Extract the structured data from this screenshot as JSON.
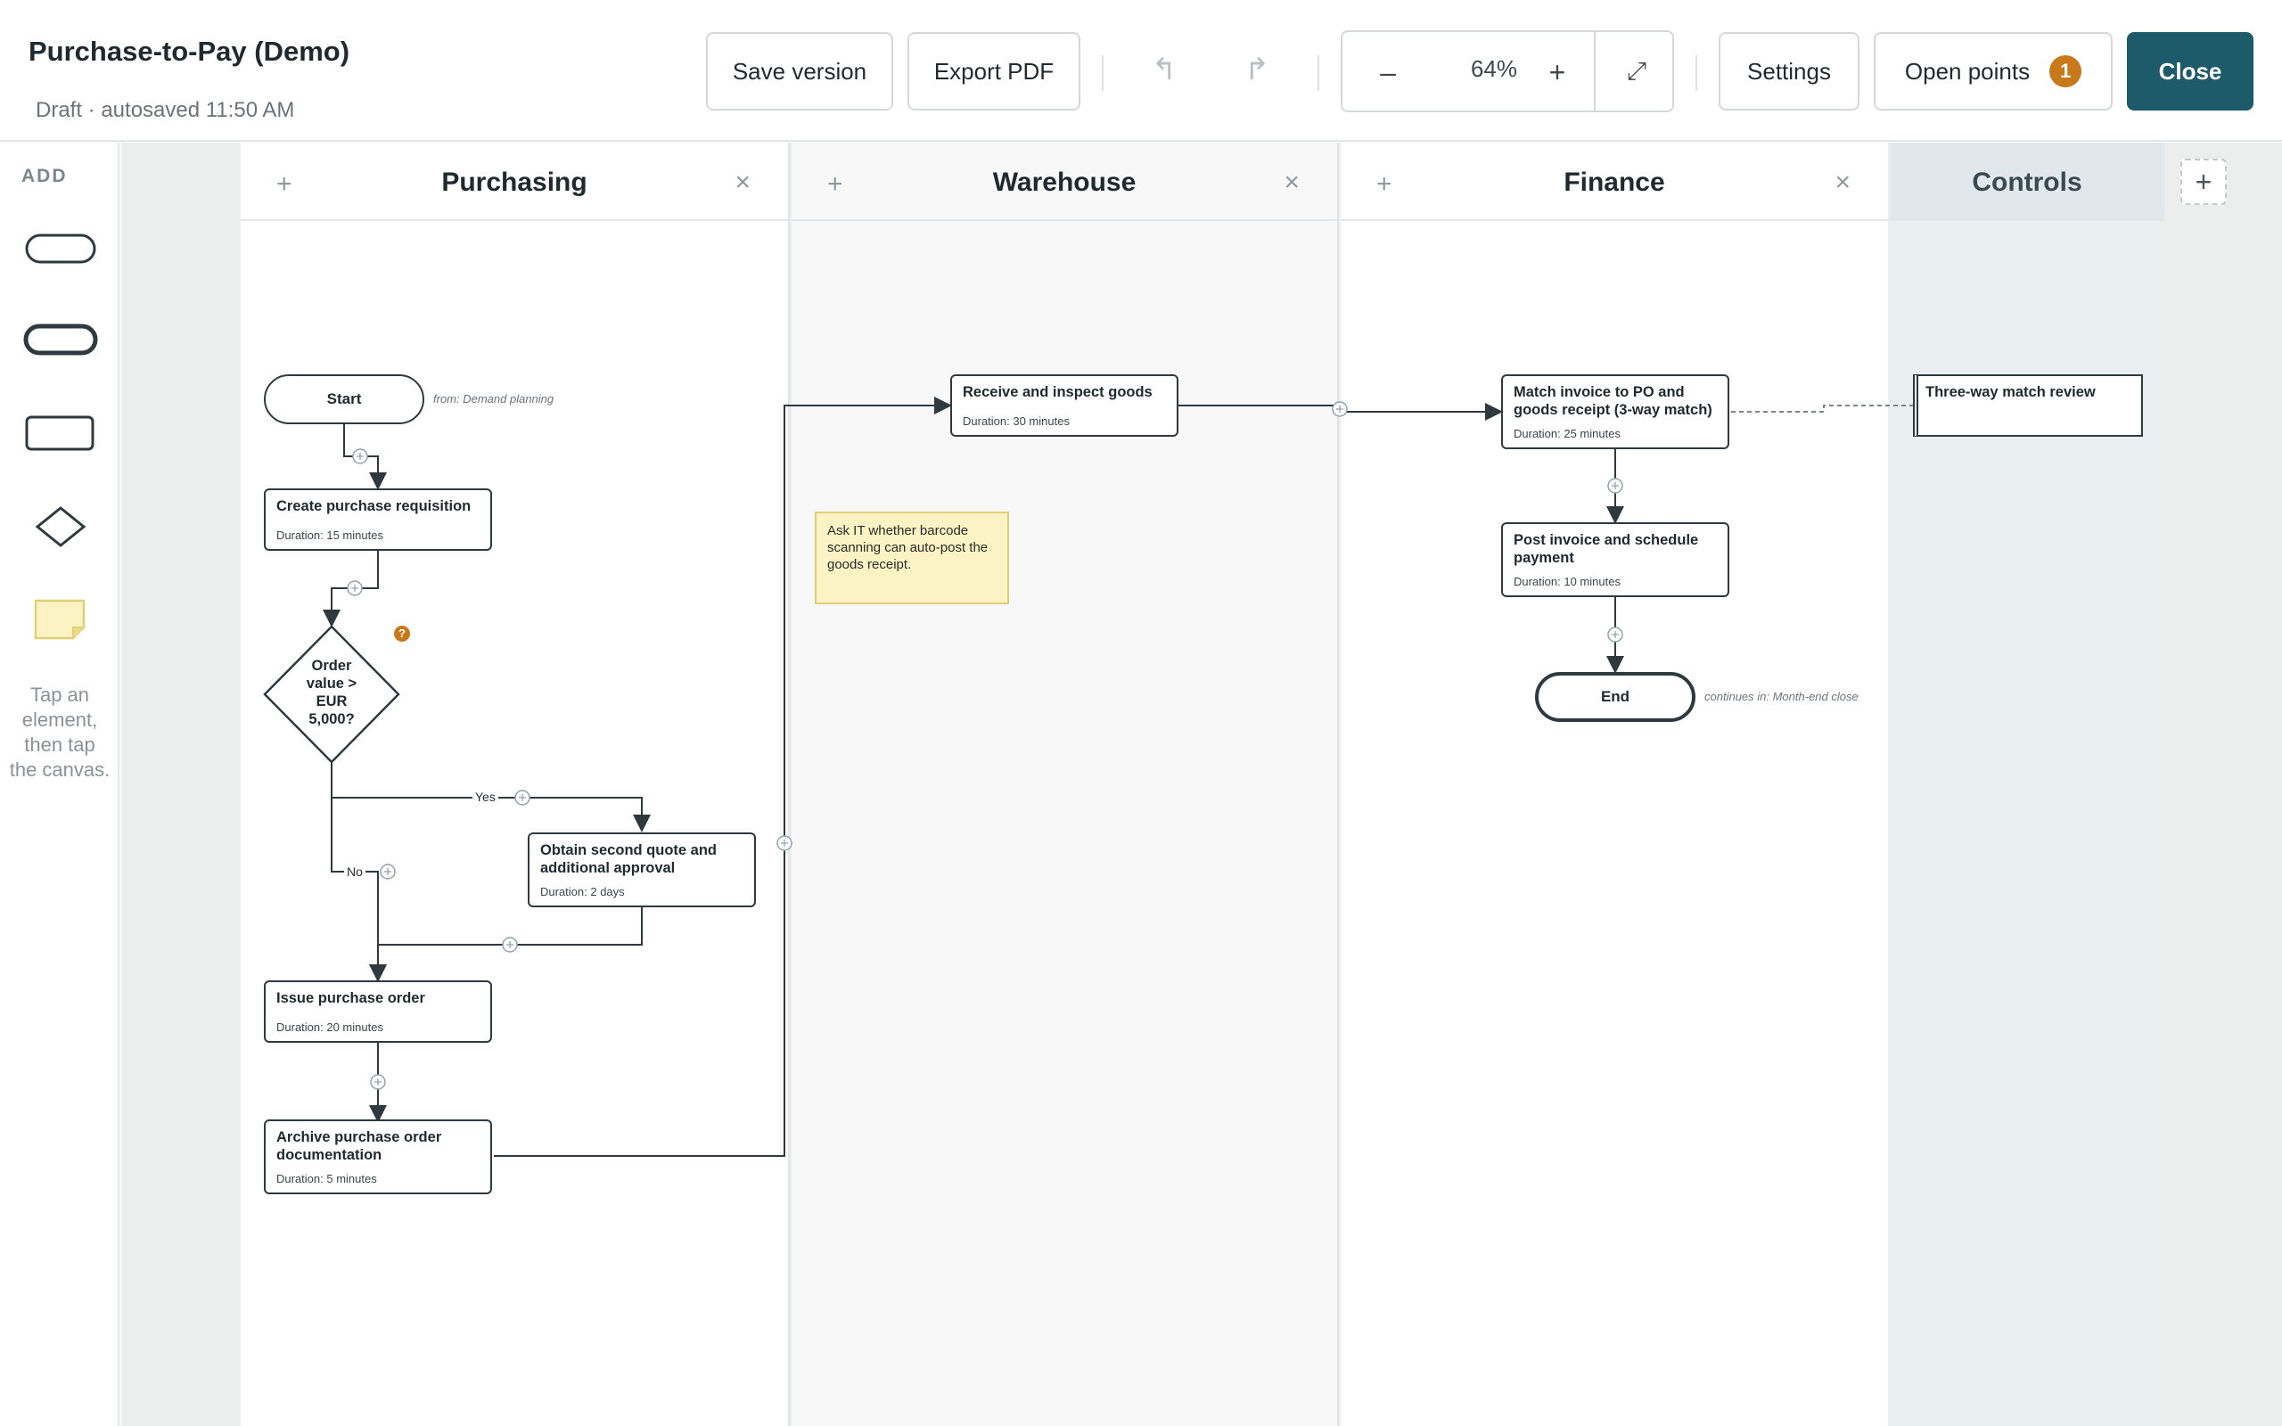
{
  "header": {
    "title": "Purchase-to-Pay (Demo)",
    "subtitle": "Draft · autosaved 11:50 AM",
    "save_version": "Save version",
    "export_pdf": "Export PDF",
    "undo_icon": "↰",
    "redo_icon": "↱",
    "zoom_minus": "–",
    "zoom_level": "64%",
    "zoom_plus": "+",
    "fit_icon": "⤢",
    "settings": "Settings",
    "open_points": "Open points",
    "open_points_count": "1",
    "close": "Close"
  },
  "palette": {
    "label": "ADD",
    "hint": "Tap an element, then tap the canvas."
  },
  "lanes": [
    {
      "title": "Purchasing",
      "add": "+",
      "remove": "×"
    },
    {
      "title": "Warehouse",
      "add": "+",
      "remove": "×"
    },
    {
      "title": "Finance",
      "add": "+",
      "remove": "×"
    },
    {
      "title": "Controls"
    }
  ],
  "add_lane": "+",
  "nodes": {
    "start": "Start",
    "start_ref": "from: Demand planning",
    "create_pr": {
      "title": "Create purchase requisition",
      "duration": "Duration: 15 minutes"
    },
    "decision": "Order value > EUR 5,000?",
    "decision_flag": "?",
    "yes": "Yes",
    "no": "No",
    "second_quote": {
      "title": "Obtain second quote and additional approval",
      "duration": "Duration: 2 days"
    },
    "issue_po": {
      "title": "Issue purchase order",
      "duration": "Duration: 20 minutes"
    },
    "archive_po": {
      "title": "Archive purchase order documentation",
      "duration": "Duration: 5 minutes"
    },
    "receive_goods": {
      "title": "Receive and inspect goods",
      "duration": "Duration: 30 minutes"
    },
    "sticky_note": "Ask IT whether barcode scanning can auto-post the goods receipt.",
    "match_invoice": {
      "title": "Match invoice to PO and goods receipt (3-way match)",
      "duration": "Duration: 25 minutes"
    },
    "post_invoice": {
      "title": "Post invoice and schedule payment",
      "duration": "Duration: 10 minutes"
    },
    "end": "End",
    "end_ref": "continues in: Month-end close",
    "control": "Three-way match review"
  }
}
